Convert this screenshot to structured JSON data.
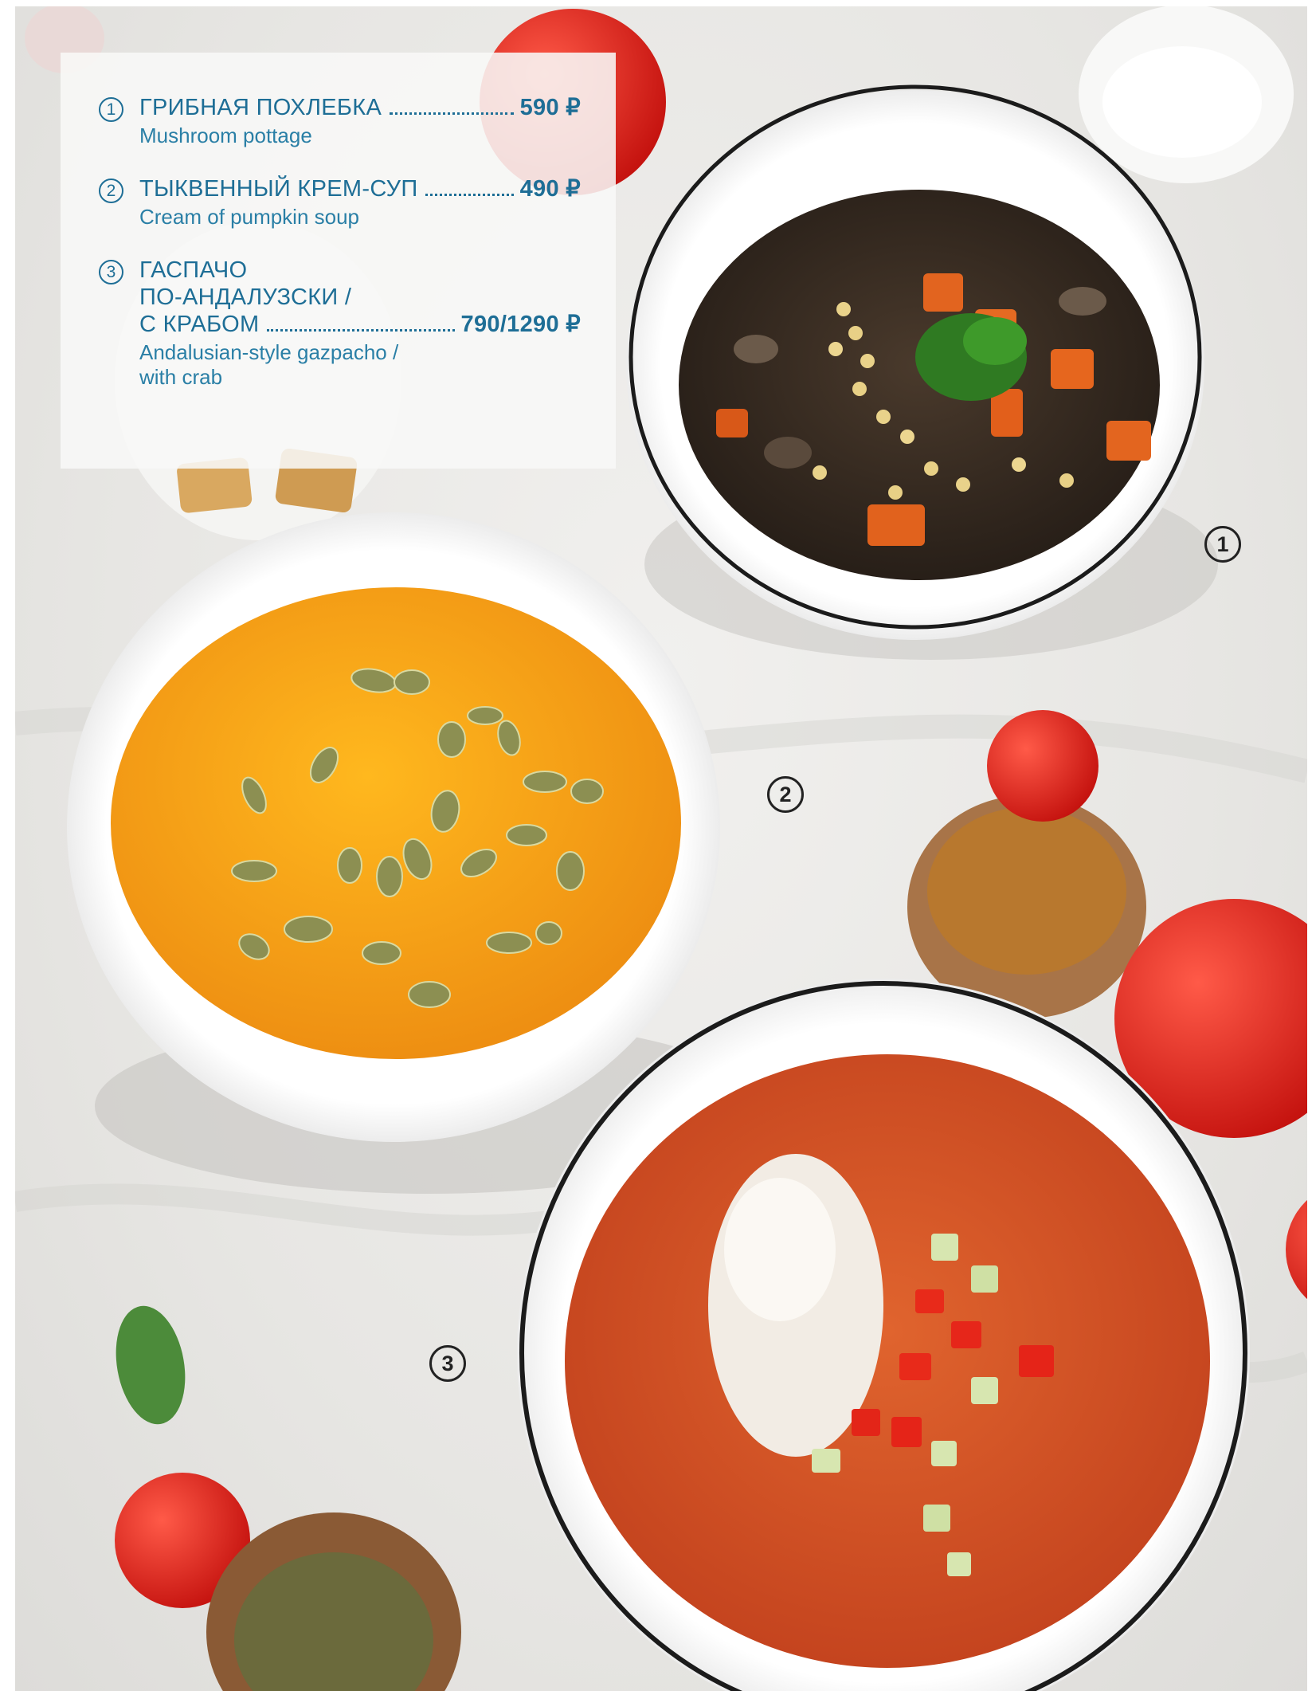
{
  "menu": {
    "items": [
      {
        "number": "1",
        "title": "ГРИБНАЯ ПОХЛЕБКА",
        "price": "590 ₽",
        "subtitle": "Mushroom pottage"
      },
      {
        "number": "2",
        "title": "ТЫКВЕННЫЙ КРЕМ-СУП",
        "price": "490 ₽",
        "subtitle": "Cream of pumpkin soup"
      },
      {
        "number": "3",
        "title_line1": "ГАСПАЧО",
        "title_line2": "ПО-АНДАЛУЗСКИ /",
        "title_line3": "С КРАБОМ",
        "price": "790/1290 ₽",
        "subtitle_line1": "Andalusian-style gazpacho /",
        "subtitle_line2": "with crab"
      }
    ]
  },
  "callouts": {
    "c1": "1",
    "c2": "2",
    "c3": "3"
  },
  "colors": {
    "menu_text": "#1e6e96",
    "pumpkin_soup": "#f2a21a",
    "gazpacho": "#d9532a",
    "mushroom_broth": "#3a2e25",
    "tomato": "#e02a22"
  }
}
